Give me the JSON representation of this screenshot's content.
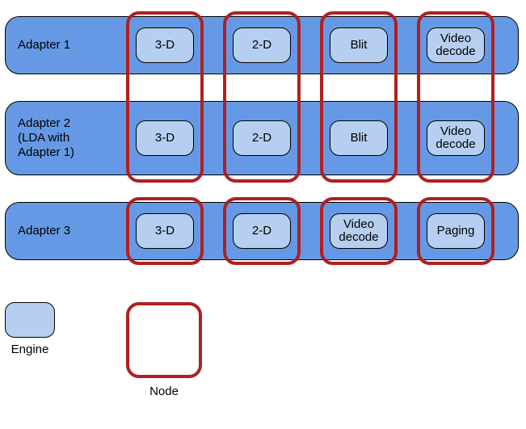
{
  "adapters": [
    {
      "label": "Adapter 1",
      "engines": [
        "3-D",
        "2-D",
        "Blit",
        "Video\ndecode"
      ]
    },
    {
      "label": "Adapter 2\n(LDA with\nAdapter 1)",
      "engines": [
        "3-D",
        "2-D",
        "Blit",
        "Video\ndecode"
      ]
    },
    {
      "label": "Adapter 3",
      "engines": [
        "3-D",
        "2-D",
        "Video\ndecode",
        "Paging"
      ]
    }
  ],
  "node_groups": [
    {
      "columns": [
        0,
        1,
        2,
        3
      ],
      "adapters": [
        0,
        1
      ]
    },
    {
      "columns": [
        0,
        1,
        2,
        3
      ],
      "adapters": [
        2
      ]
    }
  ],
  "legend": {
    "engine_label": "Engine",
    "node_label": "Node"
  }
}
